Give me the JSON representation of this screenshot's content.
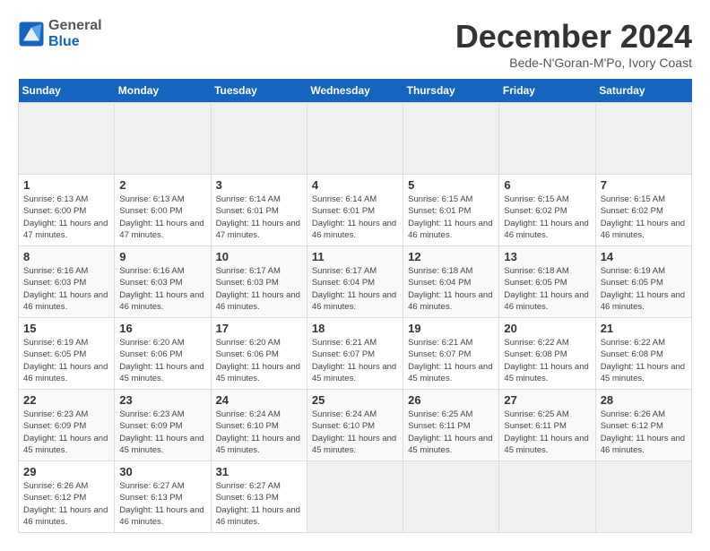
{
  "header": {
    "logo_general": "General",
    "logo_blue": "Blue",
    "month_title": "December 2024",
    "location": "Bede-N'Goran-M'Po, Ivory Coast"
  },
  "calendar": {
    "days_of_week": [
      "Sunday",
      "Monday",
      "Tuesday",
      "Wednesday",
      "Thursday",
      "Friday",
      "Saturday"
    ],
    "weeks": [
      [
        {
          "day": "",
          "empty": true
        },
        {
          "day": "",
          "empty": true
        },
        {
          "day": "",
          "empty": true
        },
        {
          "day": "",
          "empty": true
        },
        {
          "day": "",
          "empty": true
        },
        {
          "day": "",
          "empty": true
        },
        {
          "day": "",
          "empty": true
        }
      ],
      [
        {
          "day": "1",
          "sunrise": "Sunrise: 6:13 AM",
          "sunset": "Sunset: 6:00 PM",
          "daylight": "Daylight: 11 hours and 47 minutes."
        },
        {
          "day": "2",
          "sunrise": "Sunrise: 6:13 AM",
          "sunset": "Sunset: 6:00 PM",
          "daylight": "Daylight: 11 hours and 47 minutes."
        },
        {
          "day": "3",
          "sunrise": "Sunrise: 6:14 AM",
          "sunset": "Sunset: 6:01 PM",
          "daylight": "Daylight: 11 hours and 47 minutes."
        },
        {
          "day": "4",
          "sunrise": "Sunrise: 6:14 AM",
          "sunset": "Sunset: 6:01 PM",
          "daylight": "Daylight: 11 hours and 46 minutes."
        },
        {
          "day": "5",
          "sunrise": "Sunrise: 6:15 AM",
          "sunset": "Sunset: 6:01 PM",
          "daylight": "Daylight: 11 hours and 46 minutes."
        },
        {
          "day": "6",
          "sunrise": "Sunrise: 6:15 AM",
          "sunset": "Sunset: 6:02 PM",
          "daylight": "Daylight: 11 hours and 46 minutes."
        },
        {
          "day": "7",
          "sunrise": "Sunrise: 6:15 AM",
          "sunset": "Sunset: 6:02 PM",
          "daylight": "Daylight: 11 hours and 46 minutes."
        }
      ],
      [
        {
          "day": "8",
          "sunrise": "Sunrise: 6:16 AM",
          "sunset": "Sunset: 6:03 PM",
          "daylight": "Daylight: 11 hours and 46 minutes."
        },
        {
          "day": "9",
          "sunrise": "Sunrise: 6:16 AM",
          "sunset": "Sunset: 6:03 PM",
          "daylight": "Daylight: 11 hours and 46 minutes."
        },
        {
          "day": "10",
          "sunrise": "Sunrise: 6:17 AM",
          "sunset": "Sunset: 6:03 PM",
          "daylight": "Daylight: 11 hours and 46 minutes."
        },
        {
          "day": "11",
          "sunrise": "Sunrise: 6:17 AM",
          "sunset": "Sunset: 6:04 PM",
          "daylight": "Daylight: 11 hours and 46 minutes."
        },
        {
          "day": "12",
          "sunrise": "Sunrise: 6:18 AM",
          "sunset": "Sunset: 6:04 PM",
          "daylight": "Daylight: 11 hours and 46 minutes."
        },
        {
          "day": "13",
          "sunrise": "Sunrise: 6:18 AM",
          "sunset": "Sunset: 6:05 PM",
          "daylight": "Daylight: 11 hours and 46 minutes."
        },
        {
          "day": "14",
          "sunrise": "Sunrise: 6:19 AM",
          "sunset": "Sunset: 6:05 PM",
          "daylight": "Daylight: 11 hours and 46 minutes."
        }
      ],
      [
        {
          "day": "15",
          "sunrise": "Sunrise: 6:19 AM",
          "sunset": "Sunset: 6:05 PM",
          "daylight": "Daylight: 11 hours and 46 minutes."
        },
        {
          "day": "16",
          "sunrise": "Sunrise: 6:20 AM",
          "sunset": "Sunset: 6:06 PM",
          "daylight": "Daylight: 11 hours and 45 minutes."
        },
        {
          "day": "17",
          "sunrise": "Sunrise: 6:20 AM",
          "sunset": "Sunset: 6:06 PM",
          "daylight": "Daylight: 11 hours and 45 minutes."
        },
        {
          "day": "18",
          "sunrise": "Sunrise: 6:21 AM",
          "sunset": "Sunset: 6:07 PM",
          "daylight": "Daylight: 11 hours and 45 minutes."
        },
        {
          "day": "19",
          "sunrise": "Sunrise: 6:21 AM",
          "sunset": "Sunset: 6:07 PM",
          "daylight": "Daylight: 11 hours and 45 minutes."
        },
        {
          "day": "20",
          "sunrise": "Sunrise: 6:22 AM",
          "sunset": "Sunset: 6:08 PM",
          "daylight": "Daylight: 11 hours and 45 minutes."
        },
        {
          "day": "21",
          "sunrise": "Sunrise: 6:22 AM",
          "sunset": "Sunset: 6:08 PM",
          "daylight": "Daylight: 11 hours and 45 minutes."
        }
      ],
      [
        {
          "day": "22",
          "sunrise": "Sunrise: 6:23 AM",
          "sunset": "Sunset: 6:09 PM",
          "daylight": "Daylight: 11 hours and 45 minutes."
        },
        {
          "day": "23",
          "sunrise": "Sunrise: 6:23 AM",
          "sunset": "Sunset: 6:09 PM",
          "daylight": "Daylight: 11 hours and 45 minutes."
        },
        {
          "day": "24",
          "sunrise": "Sunrise: 6:24 AM",
          "sunset": "Sunset: 6:10 PM",
          "daylight": "Daylight: 11 hours and 45 minutes."
        },
        {
          "day": "25",
          "sunrise": "Sunrise: 6:24 AM",
          "sunset": "Sunset: 6:10 PM",
          "daylight": "Daylight: 11 hours and 45 minutes."
        },
        {
          "day": "26",
          "sunrise": "Sunrise: 6:25 AM",
          "sunset": "Sunset: 6:11 PM",
          "daylight": "Daylight: 11 hours and 45 minutes."
        },
        {
          "day": "27",
          "sunrise": "Sunrise: 6:25 AM",
          "sunset": "Sunset: 6:11 PM",
          "daylight": "Daylight: 11 hours and 45 minutes."
        },
        {
          "day": "28",
          "sunrise": "Sunrise: 6:26 AM",
          "sunset": "Sunset: 6:12 PM",
          "daylight": "Daylight: 11 hours and 46 minutes."
        }
      ],
      [
        {
          "day": "29",
          "sunrise": "Sunrise: 6:26 AM",
          "sunset": "Sunset: 6:12 PM",
          "daylight": "Daylight: 11 hours and 46 minutes."
        },
        {
          "day": "30",
          "sunrise": "Sunrise: 6:27 AM",
          "sunset": "Sunset: 6:13 PM",
          "daylight": "Daylight: 11 hours and 46 minutes."
        },
        {
          "day": "31",
          "sunrise": "Sunrise: 6:27 AM",
          "sunset": "Sunset: 6:13 PM",
          "daylight": "Daylight: 11 hours and 46 minutes."
        },
        {
          "day": "",
          "empty": true
        },
        {
          "day": "",
          "empty": true
        },
        {
          "day": "",
          "empty": true
        },
        {
          "day": "",
          "empty": true
        }
      ]
    ]
  }
}
